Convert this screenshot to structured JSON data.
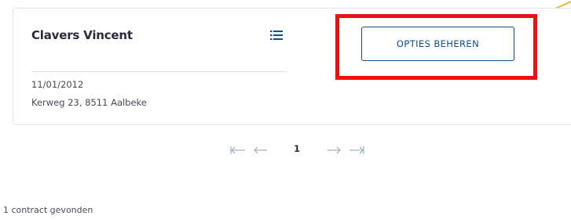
{
  "contract_card": {
    "client_name": "Clavers Vincent",
    "birth_date": "11/01/2012",
    "address": "Kerweg 23, 8511 Aalbeke",
    "manage_button_label": "OPTIES BEHEREN",
    "menu_icon": "list-icon"
  },
  "pagination": {
    "current_page": "1",
    "first_icon": "first-page-icon",
    "prev_icon": "previous-page-icon",
    "next_icon": "next-page-icon",
    "last_icon": "last-page-icon"
  },
  "results": {
    "count_text": "1 contract gevonden"
  },
  "annotation": {
    "highlight_color": "#ee1111",
    "callout_color": "#f2b233"
  },
  "colors": {
    "accent": "#0d4e8f",
    "text": "#2b2b3a",
    "muted": "#4a4a55",
    "border": "#e4e4e8",
    "pager_disabled": "#9fb4cc"
  }
}
